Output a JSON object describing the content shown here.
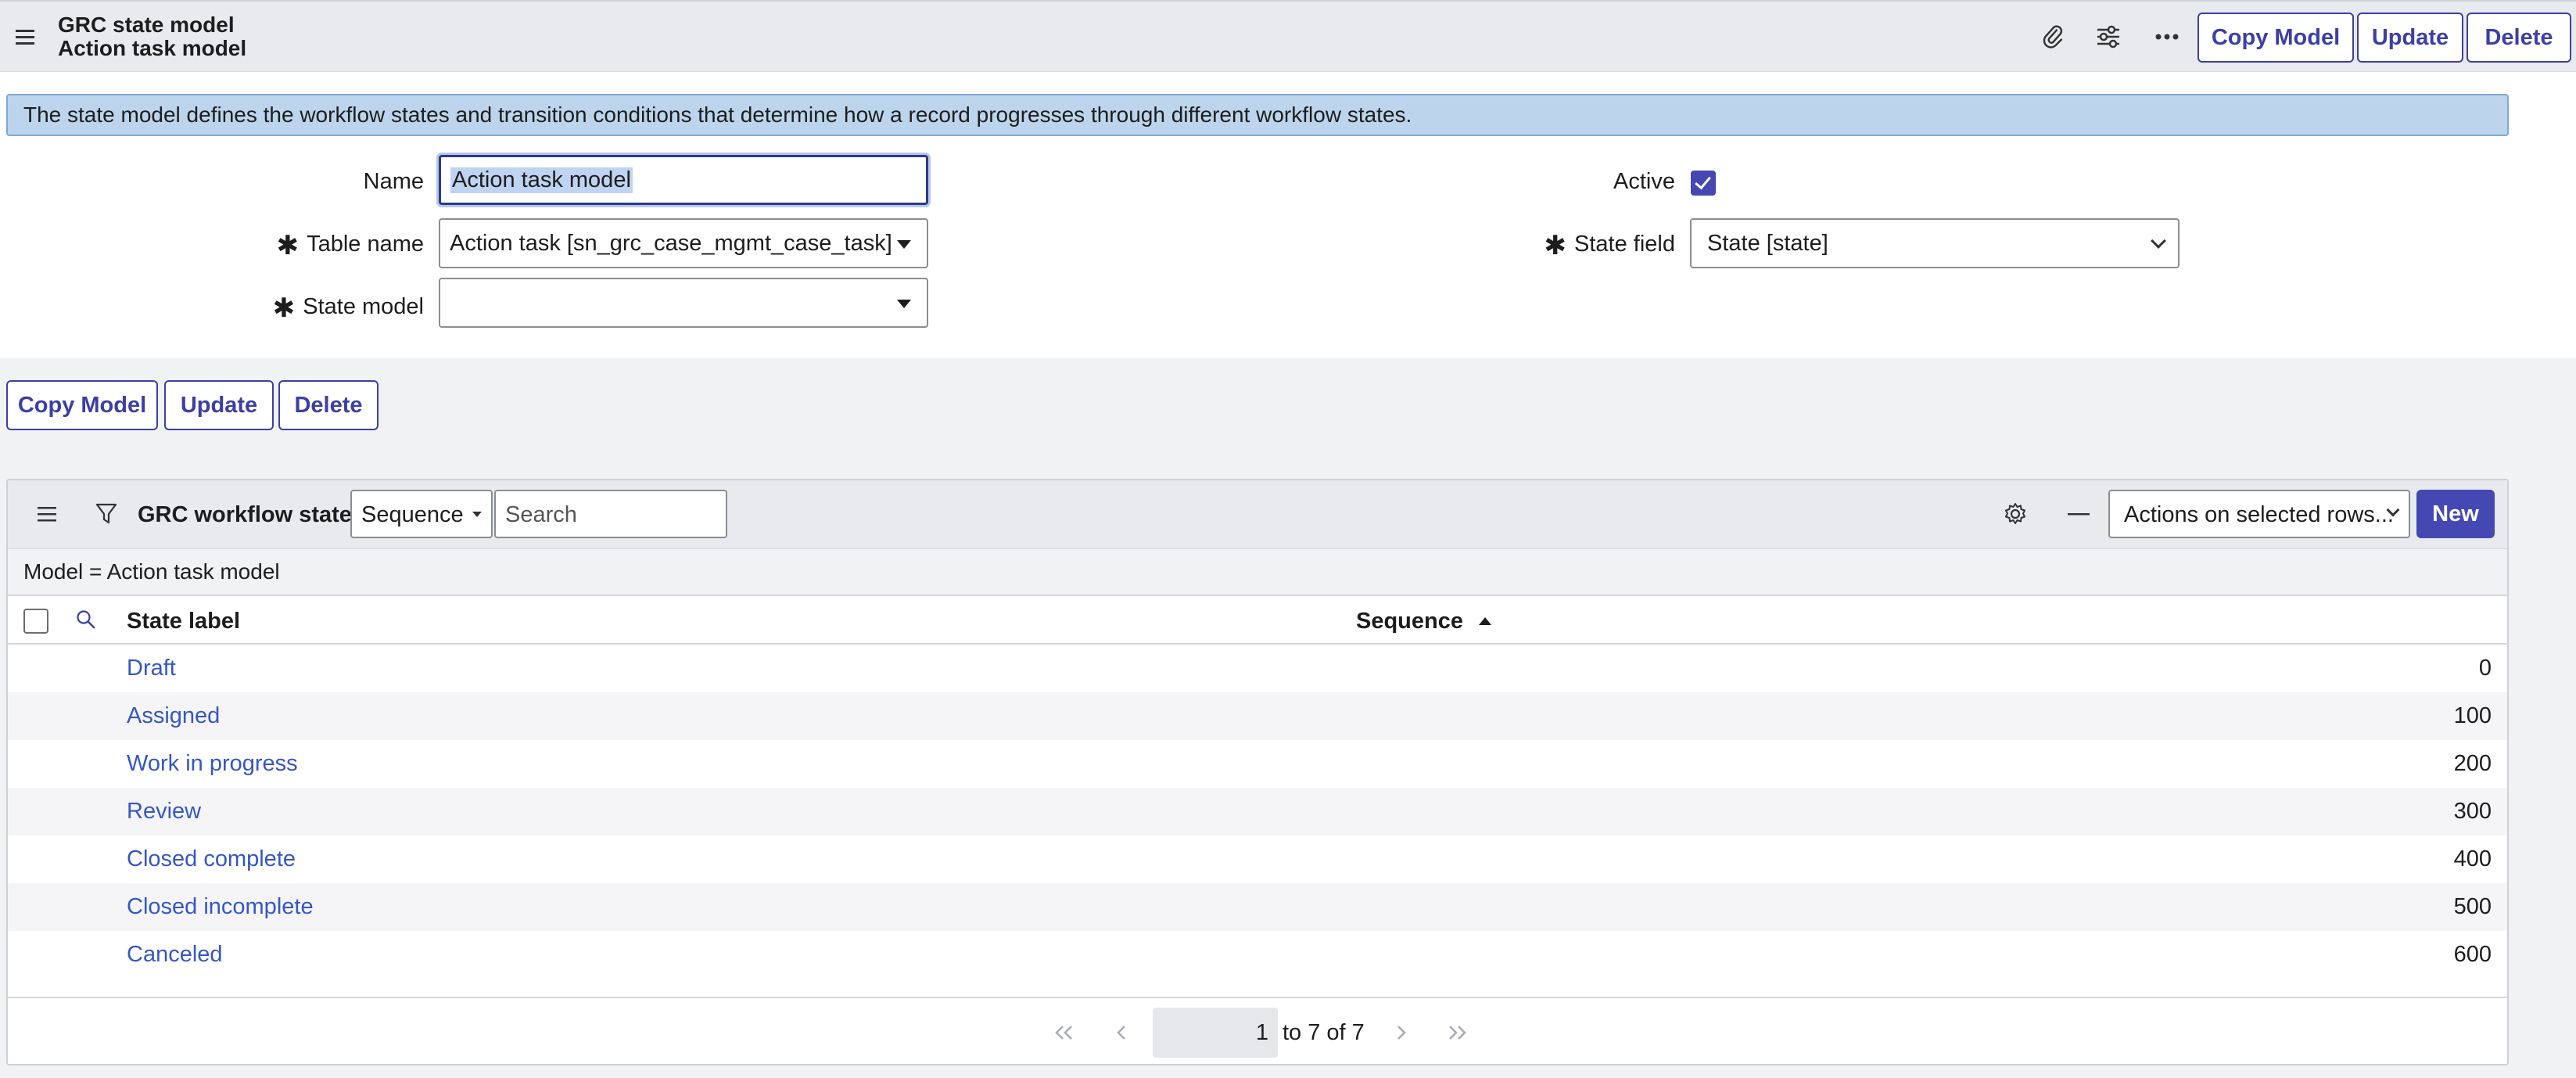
{
  "header": {
    "title": "GRC state model",
    "subtitle": "Action task model",
    "buttons": {
      "copy_model": "Copy Model",
      "update": "Update",
      "delete": "Delete"
    }
  },
  "banner": {
    "text": "The state model defines the workflow states and transition conditions that determine how a record progresses through different workflow states."
  },
  "form": {
    "name_label": "Name",
    "name_value": "Action task model",
    "table_name_label": "Table name",
    "table_name_value": "Action task [sn_grc_case_mgmt_case_task]",
    "state_model_label": "State model",
    "state_model_value": "",
    "active_label": "Active",
    "active_checked": true,
    "state_field_label": "State field",
    "state_field_value": "State [state]"
  },
  "form_buttons": {
    "copy_model": "Copy Model",
    "update": "Update",
    "delete": "Delete"
  },
  "related_list": {
    "title": "GRC workflow states",
    "search_field": "Sequence",
    "search_placeholder": "Search",
    "actions_select": "Actions on selected rows...",
    "new_label": "New",
    "filter_text": "Model = Action task model",
    "columns": {
      "state_label": "State label",
      "sequence": "Sequence"
    },
    "rows": [
      {
        "label": "Draft",
        "sequence": "0"
      },
      {
        "label": "Assigned",
        "sequence": "100"
      },
      {
        "label": "Work in progress",
        "sequence": "200"
      },
      {
        "label": "Review",
        "sequence": "300"
      },
      {
        "label": "Closed complete",
        "sequence": "400"
      },
      {
        "label": "Closed incomplete",
        "sequence": "500"
      },
      {
        "label": "Canceled",
        "sequence": "600"
      }
    ],
    "pager": {
      "current": "1",
      "range_text": "to 7 of 7"
    }
  },
  "colors": {
    "accent": "#4547b3",
    "link": "#3556c8",
    "banner_bg": "#bcd5ed"
  }
}
